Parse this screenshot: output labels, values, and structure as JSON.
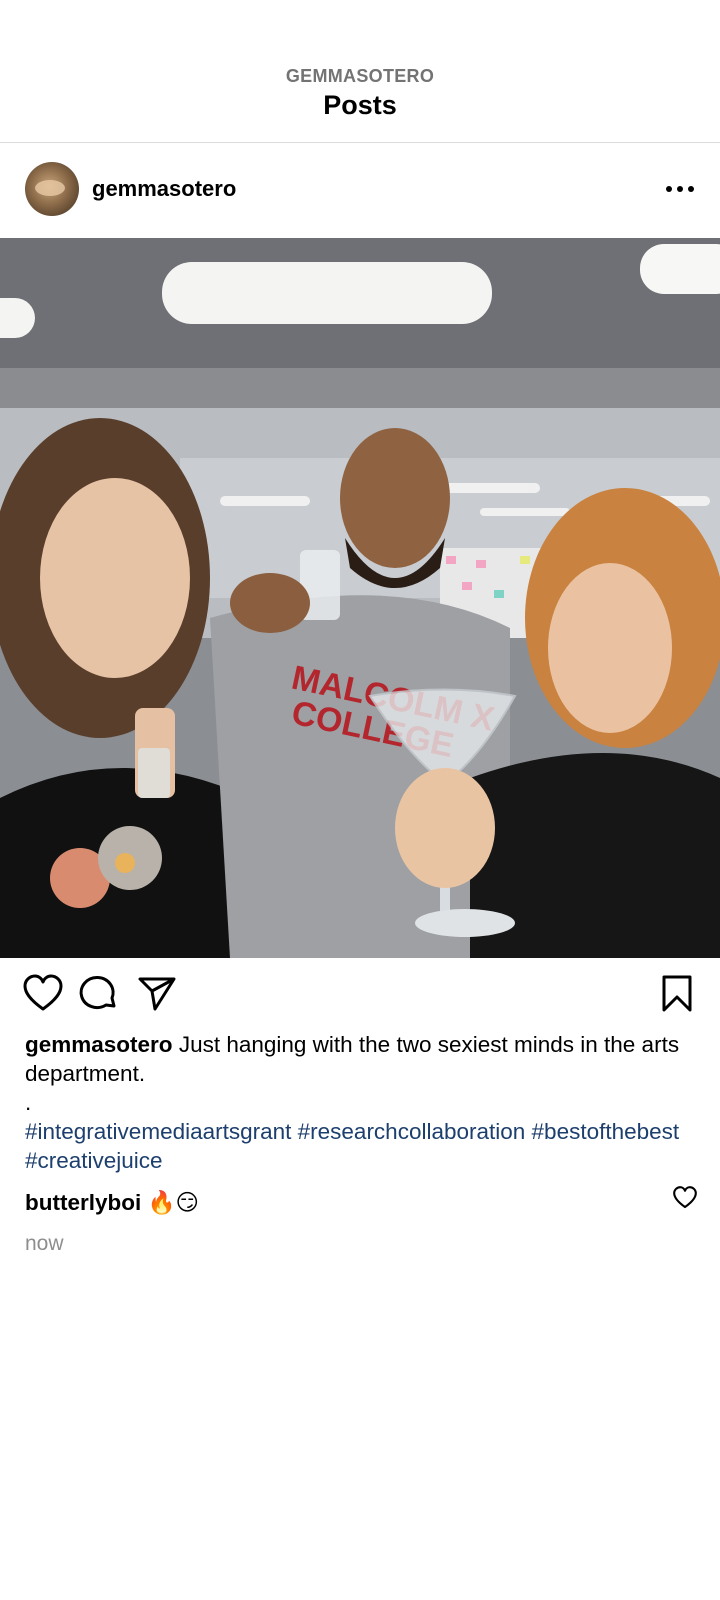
{
  "header": {
    "account_label": "GEMMASOTERO",
    "title": "Posts"
  },
  "post": {
    "username": "gemmasotero",
    "more_icon": "more-horizontal-icon",
    "image_icon": "group-photo",
    "actions": {
      "like_icon": "heart-icon",
      "comment_icon": "comment-icon",
      "share_icon": "send-icon",
      "save_icon": "bookmark-icon"
    },
    "caption": {
      "username": "gemmasotero",
      "text": "Just hanging with the two sexiest minds in the arts department.",
      "dot": ".",
      "hashtags": "#integrativemediaartsgrant #researchcollaboration #bestofthebest #creativejuice"
    },
    "comment": {
      "username": "butterlyboi",
      "text": "🔥😏"
    },
    "timestamp": "now"
  },
  "colors": {
    "hashtag": "#1d3f6e",
    "secondary_text": "#737373",
    "divider": "#dbdbdb"
  }
}
